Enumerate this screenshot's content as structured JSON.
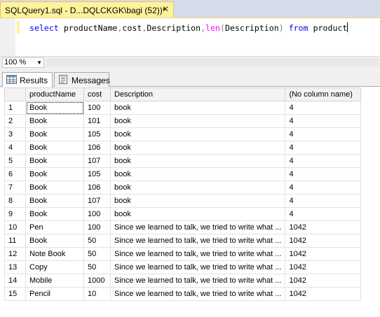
{
  "window": {
    "tab_title": "SQLQuery1.sql - D...DQLCKGK\\bagi (52))*",
    "close_glyph": "✕"
  },
  "editor": {
    "tokens": [
      {
        "t": "select",
        "c": "kw"
      },
      {
        "t": " productName",
        "c": "id"
      },
      {
        "t": ",",
        "c": "pn"
      },
      {
        "t": "cost",
        "c": "id"
      },
      {
        "t": ",",
        "c": "pn"
      },
      {
        "t": "Description",
        "c": "id"
      },
      {
        "t": ",",
        "c": "pn"
      },
      {
        "t": "len",
        "c": "fn"
      },
      {
        "t": "(",
        "c": "pn"
      },
      {
        "t": "Description",
        "c": "id"
      },
      {
        "t": ")",
        "c": "pn"
      },
      {
        "t": " from",
        "c": "kw"
      },
      {
        "t": " product",
        "c": "id"
      }
    ]
  },
  "zoom": {
    "value": "100 %"
  },
  "results_tabs": {
    "results_label": "Results",
    "messages_label": "Messages"
  },
  "grid": {
    "columns": [
      "productName",
      "cost",
      "Description",
      "(No column name)"
    ],
    "rows": [
      [
        "1",
        "Book",
        "100",
        "book",
        "4"
      ],
      [
        "2",
        "Book",
        "101",
        "book",
        "4"
      ],
      [
        "3",
        "Book",
        "105",
        "book",
        "4"
      ],
      [
        "4",
        "Book",
        "106",
        "book",
        "4"
      ],
      [
        "5",
        "Book",
        "107",
        "book",
        "4"
      ],
      [
        "6",
        "Book",
        "105",
        "book",
        "4"
      ],
      [
        "7",
        "Book",
        "106",
        "book",
        "4"
      ],
      [
        "8",
        "Book",
        "107",
        "book",
        "4"
      ],
      [
        "9",
        "Book",
        "100",
        "book",
        "4"
      ],
      [
        "10",
        "Pen",
        "100",
        "Since we learned to talk, we tried to write what ...",
        "1042"
      ],
      [
        "11",
        "Book",
        "50",
        "Since we learned to talk, we tried to write what ...",
        "1042"
      ],
      [
        "12",
        "Note Book",
        "50",
        "Since we learned to talk, we tried to write what ...",
        "1042"
      ],
      [
        "13",
        "Copy",
        "50",
        "Since we learned to talk, we tried to write what ...",
        "1042"
      ],
      [
        "14",
        "Mobile",
        "1000",
        "Since we learned to talk, we tried to write what ...",
        "1042"
      ],
      [
        "15",
        "Pencil",
        "10",
        "Since we learned to talk, we tried to write what ...",
        "1042"
      ]
    ]
  }
}
